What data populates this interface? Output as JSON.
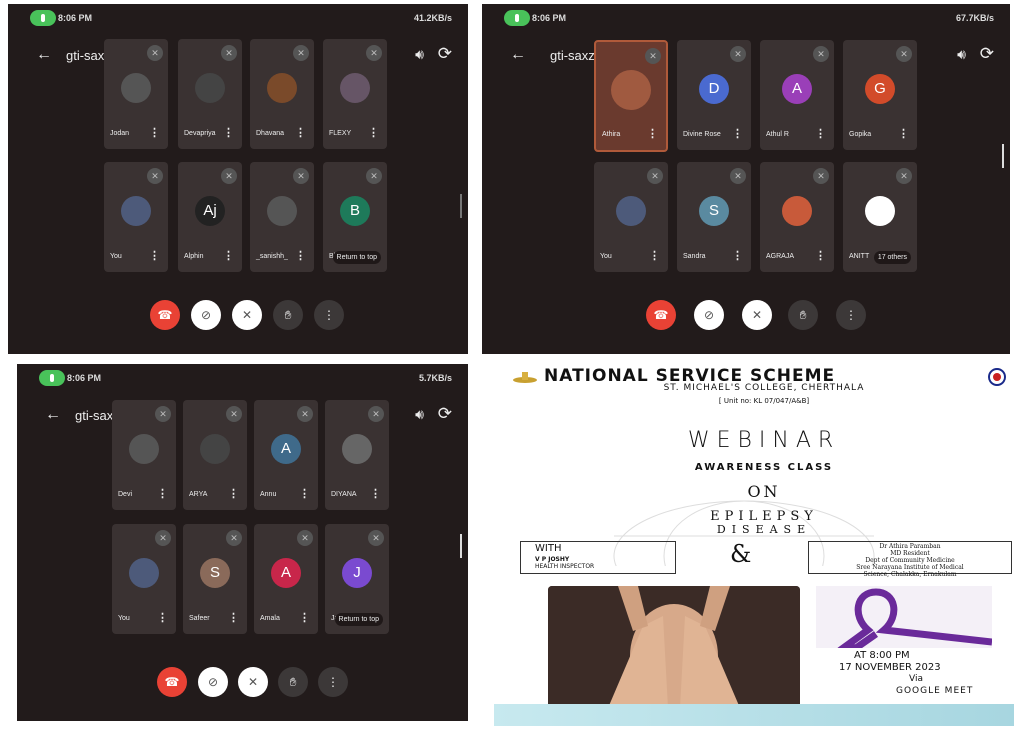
{
  "meet_code": "gti-saxz-ydd",
  "return_to_top": "Return to top",
  "panel1": {
    "time": "8:06 PM",
    "status_right": "41.2KB/s",
    "tiles": [
      {
        "name": "Jodan",
        "avatar_color": "#555"
      },
      {
        "name": "Devapriya",
        "avatar_color": "#444"
      },
      {
        "name": "Dhavana",
        "avatar_color": "#7a4a2a"
      },
      {
        "name": "FLEXY",
        "avatar_color": "#665566"
      },
      {
        "name": "You",
        "avatar_color": "#4d5a7a"
      },
      {
        "name": "Alphin",
        "avatar_letter": "Aj",
        "avatar_color": "#222"
      },
      {
        "name": "_sanishh_",
        "avatar_color": "#555"
      },
      {
        "name": "Bh",
        "avatar_letter": "B",
        "avatar_color": "#1e7a5a"
      }
    ]
  },
  "panel2": {
    "time": "8:06 PM",
    "status_right": "67.7KB/s",
    "tiles": [
      {
        "name": "Athira",
        "avatar_color": "#a05a40"
      },
      {
        "name": "Divine Rose",
        "avatar_letter": "D",
        "avatar_color": "#4a6ad0"
      },
      {
        "name": "Athul R",
        "avatar_letter": "A",
        "avatar_color": "#9a3fb8"
      },
      {
        "name": "Gopika",
        "avatar_letter": "G",
        "avatar_color": "#d24b2a"
      },
      {
        "name": "You",
        "avatar_color": "#4d5a7a"
      },
      {
        "name": "Sandra",
        "avatar_letter": "S",
        "avatar_color": "#5a8aa0"
      },
      {
        "name": "AGRAJA",
        "avatar_color": "#c85a3a"
      },
      {
        "name": "ANITT",
        "avatar_color": "#ffffff"
      }
    ],
    "others": "17 others"
  },
  "panel3": {
    "time": "8:06 PM",
    "status_right": "5.7KB/s",
    "tiles": [
      {
        "name": "Devi",
        "avatar_color": "#555"
      },
      {
        "name": "ARYA",
        "avatar_color": "#444"
      },
      {
        "name": "Annu",
        "avatar_letter": "A",
        "avatar_color": "#3f6a8a"
      },
      {
        "name": "DIYANA",
        "avatar_color": "#666"
      },
      {
        "name": "You",
        "avatar_color": "#4d5a7a"
      },
      {
        "name": "Safeer",
        "avatar_letter": "S",
        "avatar_color": "#8a6a5a"
      },
      {
        "name": "Amala",
        "avatar_letter": "A",
        "avatar_color": "#c8264a"
      },
      {
        "name": "Ja",
        "avatar_letter": "J",
        "avatar_color": "#7a4ad0"
      }
    ]
  },
  "poster": {
    "org": "NATIONAL SERVICE SCHEME",
    "college": "ST. MICHAEL'S COLLEGE, CHERTHALA",
    "unit": "[ Unit no: KL 07/047/A&B]",
    "webinar": "WEBINAR",
    "awareness": "AWARENESS CLASS",
    "on": "ON",
    "epilepsy": "EPILEPSY",
    "disease": "DISEASE",
    "with": "WITH",
    "speaker1_name": "V P JOSHY",
    "speaker1_role": "HEALTH INSPECTOR",
    "amp": "&",
    "speaker2_line1": "Dr Athira Paramban",
    "speaker2_line2": "MD Resident",
    "speaker2_line3": "Dept of Community Medicine",
    "speaker2_line4": "Sree Narayana Institute of Medical",
    "speaker2_line5": "Science, Chalakka, Ernakulam",
    "time": "AT 8:00 PM",
    "date": "17 NOVEMBER 2023",
    "via": "Via",
    "platform": "GOOGLE MEET"
  }
}
